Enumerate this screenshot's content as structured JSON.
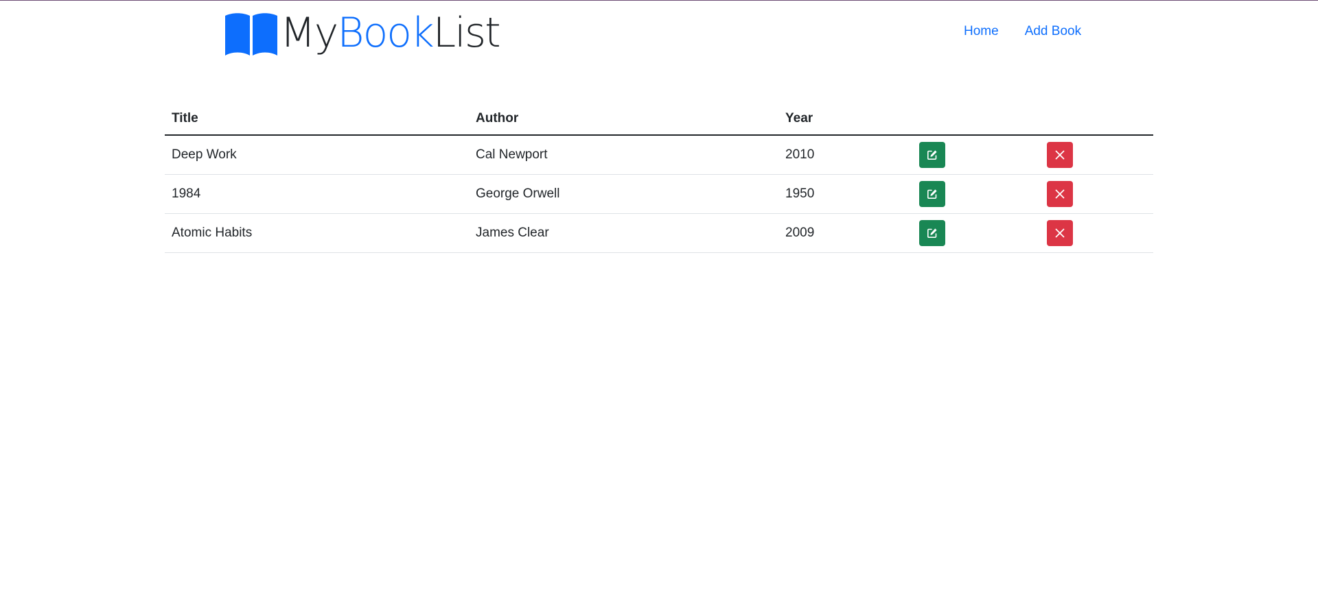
{
  "brand": {
    "part1": "My",
    "part2": "Book",
    "part3": "List",
    "icon": "open-book-icon"
  },
  "nav": {
    "home_label": "Home",
    "add_book_label": "Add Book"
  },
  "table": {
    "headers": {
      "title": "Title",
      "author": "Author",
      "year": "Year"
    },
    "rows": [
      {
        "title": "Deep Work",
        "author": "Cal Newport",
        "year": "2010"
      },
      {
        "title": "1984",
        "author": "George Orwell",
        "year": "1950"
      },
      {
        "title": "Atomic Habits",
        "author": "James Clear",
        "year": "2009"
      }
    ]
  },
  "icons": {
    "edit": "edit-icon",
    "delete": "close-icon"
  },
  "colors": {
    "primary": "#0d6efd",
    "edit_button": "#198754",
    "delete_button": "#dc3545",
    "text": "#212529"
  }
}
